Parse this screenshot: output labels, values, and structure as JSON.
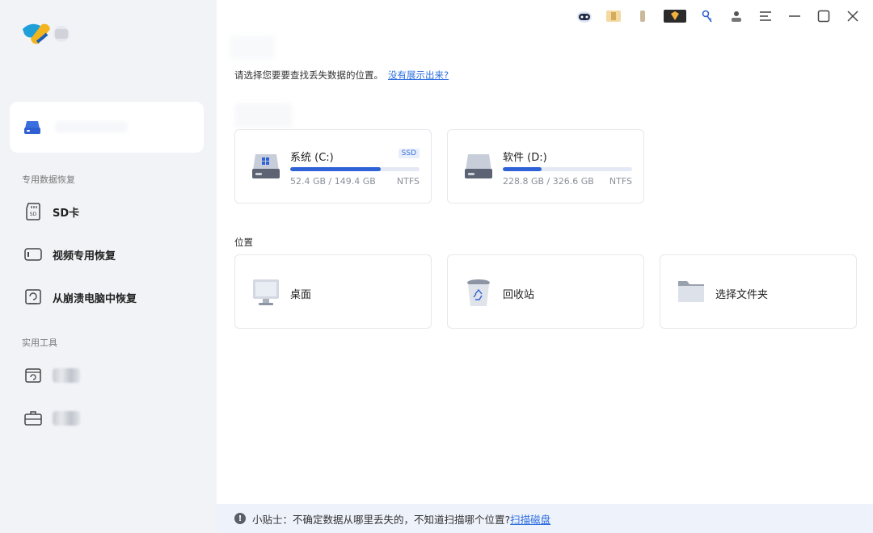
{
  "sidebar": {
    "section_recovery": "专用数据恢复",
    "items": [
      {
        "label": "SD卡",
        "icon": "sd-card-icon"
      },
      {
        "label": "视频专用恢复",
        "icon": "video-camera-icon"
      },
      {
        "label": "从崩溃电脑中恢复",
        "icon": "crashed-pc-icon"
      }
    ],
    "section_tools": "实用工具"
  },
  "main": {
    "prompt": "请选择您要要查找丢失数据的位置。",
    "prompt_link": "没有展示出来?",
    "drives": [
      {
        "name": "系统 (C:)",
        "badge": "SSD",
        "size": "52.4 GB / 149.4 GB",
        "fs": "NTFS",
        "used_fraction": 0.7
      },
      {
        "name": "软件 (D:)",
        "badge": "",
        "size": "228.8 GB / 326.6 GB",
        "fs": "NTFS",
        "used_fraction": 0.3
      }
    ],
    "locations_label": "位置",
    "locations": [
      {
        "name": "桌面",
        "icon": "desktop-monitor-icon"
      },
      {
        "name": "回收站",
        "icon": "recycle-bin-icon"
      },
      {
        "name": "选择文件夹",
        "icon": "folder-icon"
      }
    ]
  },
  "tip": {
    "text": "小贴士：不确定数据从哪里丢失的，不知道扫描哪个位置?",
    "link": "扫描磁盘"
  },
  "colors": {
    "accent": "#2f62d6",
    "sidebar_bg": "#f1f3f7",
    "tip_bg": "#eef2fb"
  }
}
